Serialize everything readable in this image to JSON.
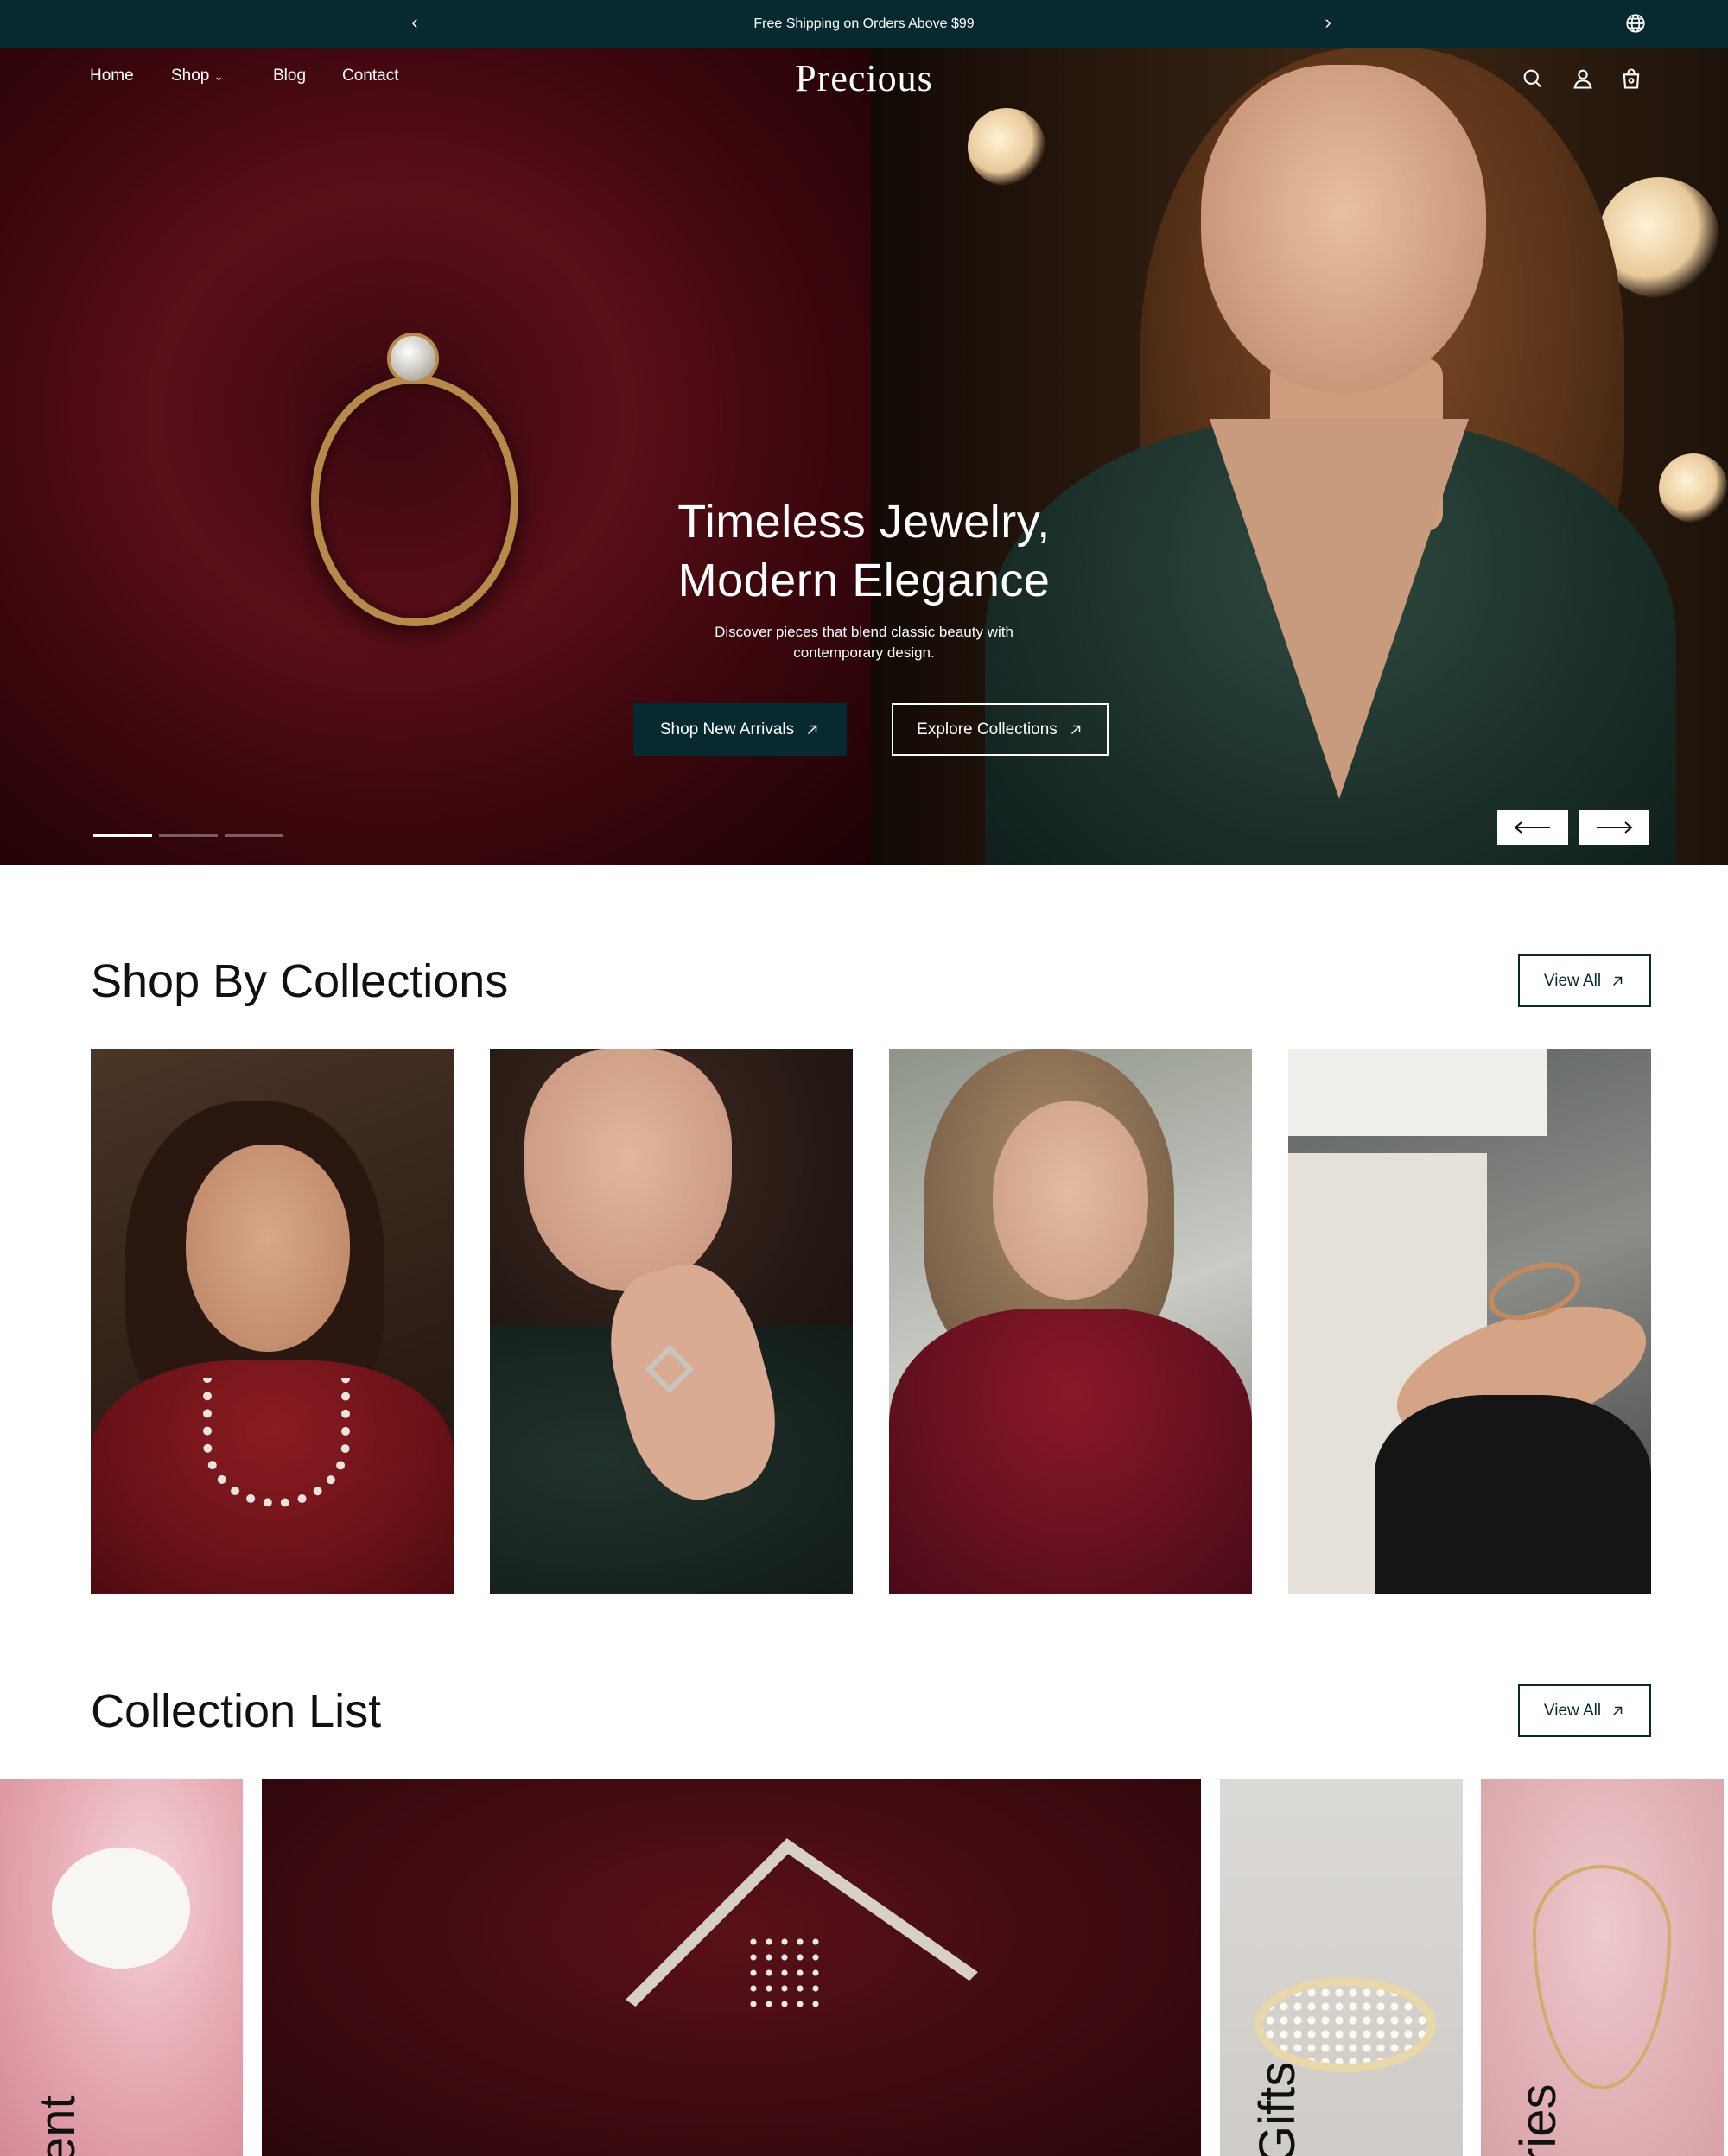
{
  "announcement": {
    "message": "Free Shipping on Orders Above $99",
    "prev_icon": "chevron-left-icon",
    "next_icon": "chevron-right-icon",
    "language_icon": "globe-icon"
  },
  "nav": {
    "items": [
      {
        "label": "Home"
      },
      {
        "label": "Shop",
        "has_dropdown": true
      },
      {
        "label": "Blog"
      },
      {
        "label": "Contact"
      }
    ],
    "logo": "Precious",
    "icons": [
      "search-icon",
      "account-icon",
      "cart-icon"
    ]
  },
  "hero": {
    "title_line1": "Timeless Jewelry,",
    "title_line2": "Modern Elegance",
    "subtitle_line1": "Discover pieces that blend classic beauty with",
    "subtitle_line2": "contemporary design.",
    "primary_button": "Shop New Arrivals",
    "secondary_button": "Explore Collections",
    "slide_count": 3,
    "active_slide": 1,
    "prev_arrow": "arrow-left-icon",
    "next_arrow": "arrow-right-icon"
  },
  "collections": {
    "title": "Shop By Collections",
    "view_all": "View All",
    "cards": [
      {
        "image": "woman-with-necklace"
      },
      {
        "image": "woman-with-ring"
      },
      {
        "image": "woman-with-earring"
      },
      {
        "image": "hands-with-rings-and-bracelets"
      }
    ]
  },
  "collection_list": {
    "title": "Collection List",
    "view_all": "View All",
    "items": [
      {
        "label": "ent"
      },
      {
        "label": ""
      },
      {
        "label": "Gifts"
      },
      {
        "label": "ries"
      }
    ]
  },
  "colors": {
    "brand_dark_teal": "#072a30",
    "hero_red": "#5a0e18",
    "white": "#ffffff"
  }
}
